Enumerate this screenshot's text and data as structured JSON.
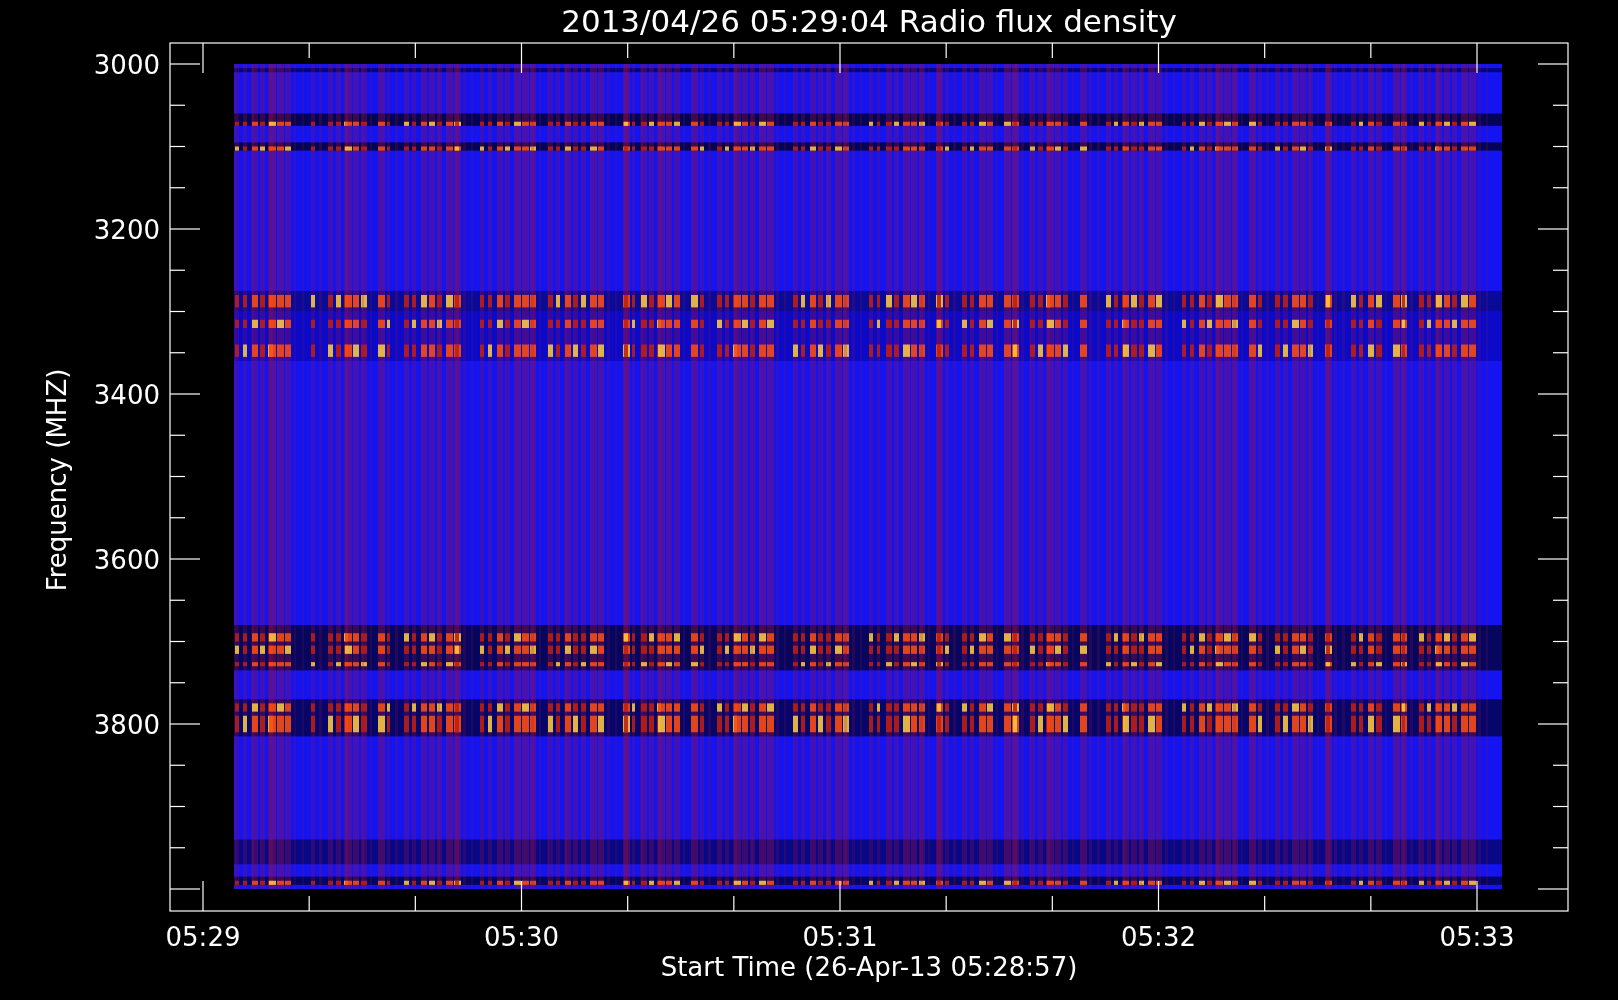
{
  "title": "2013/04/26 05:29:04 Radio flux density",
  "y_axis": {
    "label": "Frequency (MHZ)",
    "ticks": [
      "3000",
      "3200",
      "3400",
      "3600",
      "3800"
    ]
  },
  "x_axis": {
    "label": "Start Time (26-Apr-13 05:28:57)",
    "ticks": [
      "05:29",
      "05:30",
      "05:31",
      "05:32",
      "05:33"
    ]
  }
}
